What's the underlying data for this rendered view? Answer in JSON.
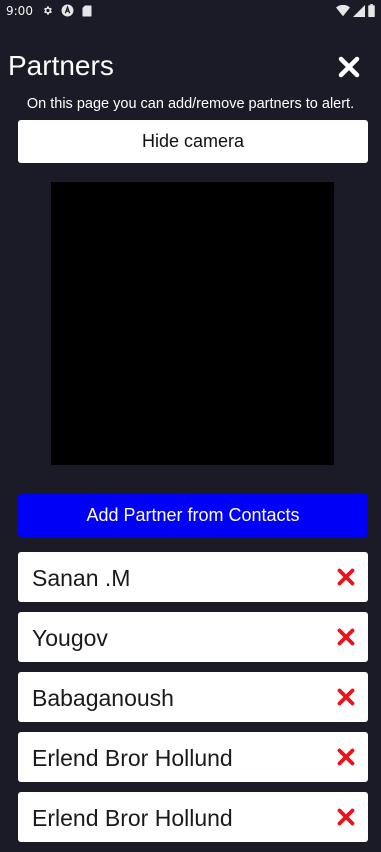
{
  "status_bar": {
    "time": "9:00",
    "icons_left": [
      "gear-icon",
      "at-icon",
      "sd-card-icon"
    ],
    "icons_right": [
      "wifi-icon",
      "signal-icon",
      "battery-icon"
    ]
  },
  "header": {
    "title": "Partners",
    "close_icon": "close-icon"
  },
  "subtitle": "On this page you can add/remove partners to alert.",
  "buttons": {
    "hide_camera": "Hide camera",
    "add_partner": "Add Partner from Contacts"
  },
  "partners": [
    {
      "name": "Sanan .M"
    },
    {
      "name": "Yougov"
    },
    {
      "name": "Babaganoush"
    },
    {
      "name": "Erlend Bror Hollund"
    },
    {
      "name": "Erlend Bror Hollund"
    }
  ],
  "colors": {
    "background": "#1b1b27",
    "primary_button": "#0000f6",
    "remove_icon": "#e8141c",
    "card": "#ffffff"
  }
}
